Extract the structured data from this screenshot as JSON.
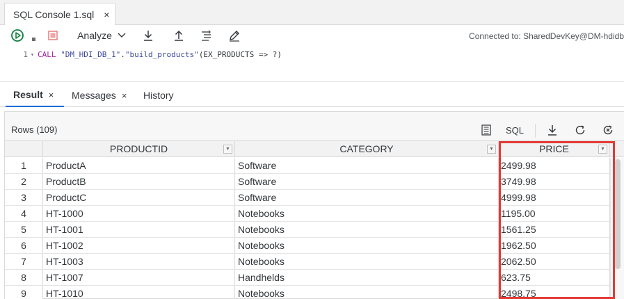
{
  "editor_tab": {
    "title": "SQL Console 1.sql",
    "close": "×"
  },
  "toolbar": {
    "run_icon": "play-circle-icon",
    "stop_icon": "stop-icon",
    "analyze_label": "Analyze",
    "download_icon": "download-icon",
    "upload_icon": "upload-icon",
    "format_icon": "format-icon",
    "edit_icon": "edit-icon",
    "connection_text": "Connected to: SharedDevKey@DM-hdidb"
  },
  "editor": {
    "line_number": "1",
    "tokens": {
      "kw": "CALL",
      "str1": "\"DM_HDI_DB_1\"",
      "dot": ".",
      "str2": "\"build_products\"",
      "rest": "(EX_PRODUCTS => ?)"
    }
  },
  "result_tabs": [
    {
      "label": "Result",
      "close": "×",
      "active": true
    },
    {
      "label": "Messages",
      "close": "×",
      "active": false
    },
    {
      "label": "History",
      "active": false
    }
  ],
  "panel": {
    "rows_label": "Rows (109)",
    "sql_label": "SQL"
  },
  "table": {
    "columns": [
      "PRODUCTID",
      "CATEGORY",
      "PRICE"
    ],
    "rows": [
      {
        "n": "1",
        "id": "ProductA",
        "cat": "Software",
        "price": "2499.98"
      },
      {
        "n": "2",
        "id": "ProductB",
        "cat": "Software",
        "price": "3749.98"
      },
      {
        "n": "3",
        "id": "ProductC",
        "cat": "Software",
        "price": "4999.98"
      },
      {
        "n": "4",
        "id": "HT-1000",
        "cat": "Notebooks",
        "price": "1195.00"
      },
      {
        "n": "5",
        "id": "HT-1001",
        "cat": "Notebooks",
        "price": "1561.25"
      },
      {
        "n": "6",
        "id": "HT-1002",
        "cat": "Notebooks",
        "price": "1962.50"
      },
      {
        "n": "7",
        "id": "HT-1003",
        "cat": "Notebooks",
        "price": "2062.50"
      },
      {
        "n": "8",
        "id": "HT-1007",
        "cat": "Handhelds",
        "price": "623.75"
      },
      {
        "n": "9",
        "id": "HT-1010",
        "cat": "Notebooks",
        "price": "2498.75"
      }
    ]
  },
  "colors": {
    "accent": "#0a6ed1",
    "highlight": "#e53935",
    "run_green": "#107e3e",
    "stop_red": "#e57373"
  }
}
